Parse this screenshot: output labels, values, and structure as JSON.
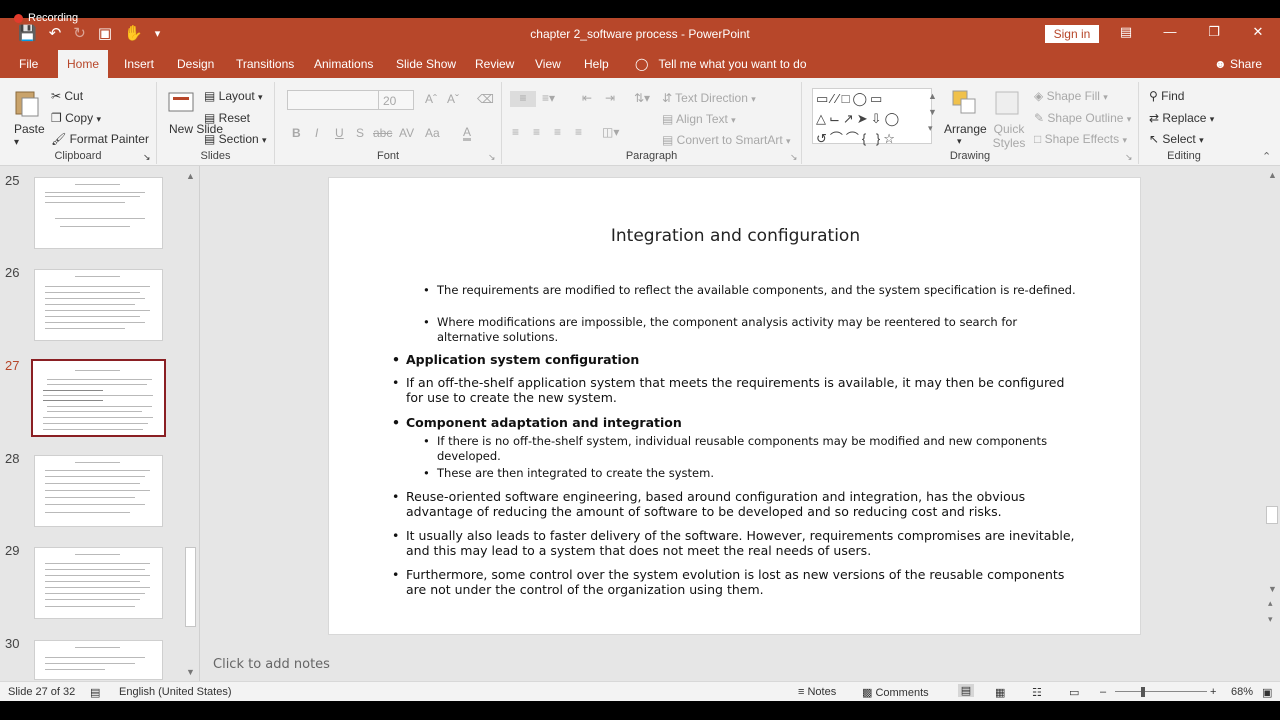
{
  "recording": {
    "label": "Recording"
  },
  "window": {
    "title": "chapter 2_software process  -  PowerPoint",
    "sign_in": "Sign in"
  },
  "tabs": [
    "File",
    "Home",
    "Insert",
    "Design",
    "Transitions",
    "Animations",
    "Slide Show",
    "Review",
    "View",
    "Help"
  ],
  "active_tab": "Home",
  "tell_me": "Tell me what you want to do",
  "share": "Share",
  "ribbon": {
    "clipboard": {
      "paste": "Paste",
      "cut": "Cut",
      "copy": "Copy",
      "format_painter": "Format Painter",
      "label": "Clipboard"
    },
    "slides": {
      "new_slide": "New Slide",
      "layout": "Layout",
      "reset": "Reset",
      "section": "Section",
      "label": "Slides"
    },
    "font": {
      "size": "20",
      "label": "Font",
      "buttons": [
        "B",
        "I",
        "U",
        "S",
        "abc",
        "AV",
        "Aa"
      ]
    },
    "paragraph": {
      "text_direction": "Text Direction",
      "align_text": "Align Text",
      "convert": "Convert to SmartArt",
      "label": "Paragraph"
    },
    "drawing": {
      "arrange": "Arrange",
      "quick_styles": "Quick Styles",
      "shape_fill": "Shape Fill",
      "shape_outline": "Shape Outline",
      "shape_effects": "Shape Effects",
      "label": "Drawing"
    },
    "editing": {
      "find": "Find",
      "replace": "Replace",
      "select": "Select",
      "label": "Editing"
    }
  },
  "thumbnails": [
    {
      "num": "25"
    },
    {
      "num": "26"
    },
    {
      "num": "27"
    },
    {
      "num": "28"
    },
    {
      "num": "29"
    },
    {
      "num": "30"
    }
  ],
  "slide": {
    "title": "Integration and configuration",
    "bullets": [
      {
        "level": 2,
        "text": "The requirements are modified to reflect the available components, and the system specification is re-defined."
      },
      {
        "level": 2,
        "text": "Where modifications are impossible, the component analysis activity may be reentered to search for alternative solutions."
      },
      {
        "level": 1,
        "bold": true,
        "text": "Application system configuration"
      },
      {
        "level": 1,
        "text": "If an off-the-shelf application system that meets the requirements is available, it may then be configured for use to create the new system."
      },
      {
        "level": 1,
        "bold": true,
        "text": "Component adaptation and integration"
      },
      {
        "level": 2,
        "text": " If there is no off-the-shelf system, individual reusable components may be modified and new components developed."
      },
      {
        "level": 2,
        "text": "These are then integrated to create the system."
      },
      {
        "level": 1,
        "text": "Reuse-oriented software engineering, based around configuration and integration, has the obvious advantage of reducing the amount of software to be developed and so reducing cost and risks."
      },
      {
        "level": 1,
        "text": "It usually also leads to faster delivery of the software. However, requirements compromises are inevitable, and this may lead to a system that does not meet the real needs of users."
      },
      {
        "level": 1,
        "text": "Furthermore, some control over the system evolution is lost as new versions of the reusable components are not under the control of the organization using them."
      }
    ]
  },
  "notes_placeholder": "Click to add notes",
  "status": {
    "slide": "Slide 27 of 32",
    "language": "English (United States)",
    "notes": "Notes",
    "comments": "Comments",
    "zoom": "68%"
  }
}
